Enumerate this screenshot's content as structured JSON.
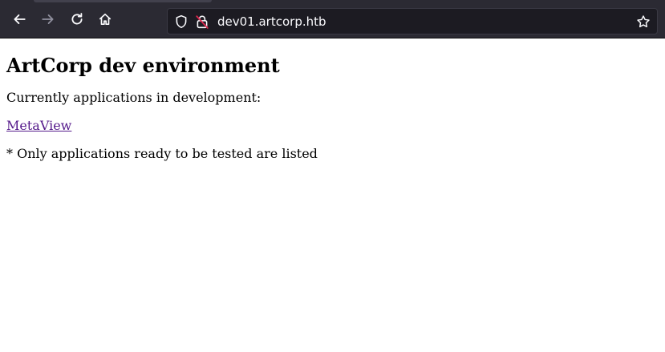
{
  "browser": {
    "url": "dev01.artcorp.htb",
    "icons": [
      "back-arrow-icon",
      "forward-arrow-icon",
      "reload-icon",
      "home-icon",
      "shield-icon",
      "insecure-lock-icon",
      "star-icon"
    ]
  },
  "page": {
    "heading": "ArtCorp dev environment",
    "intro": "Currently applications in development:",
    "link_label": "MetaView",
    "note": "* Only applications ready to be tested are listed",
    "link_color": "#551a8b"
  }
}
